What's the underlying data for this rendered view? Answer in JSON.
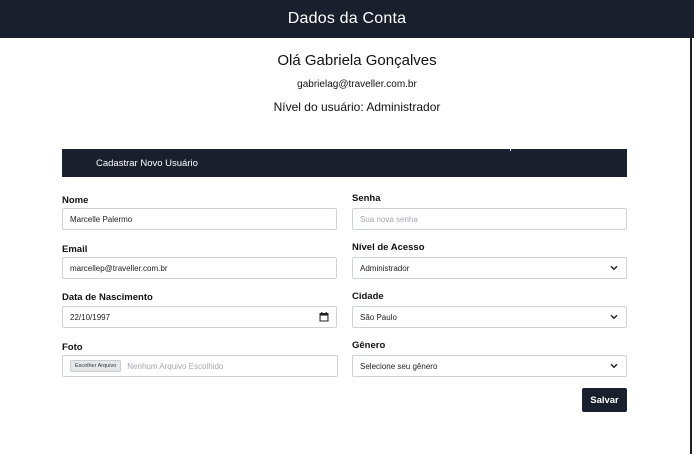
{
  "header": {
    "title": "Dados da Conta"
  },
  "profile": {
    "greeting": "Olá Gabriela Gonçalves",
    "email": "gabrielag@traveller.com.br",
    "level": "Nível do usuário: Administrador"
  },
  "form": {
    "section_title": "Cadastrar Novo Usuário",
    "name": {
      "label": "Nome",
      "value": "Marcelle Palermo"
    },
    "password": {
      "label": "Senha",
      "placeholder": "Sua nova senha"
    },
    "email": {
      "label": "Email",
      "value": "marcellep@traveller.com.br"
    },
    "access_level": {
      "label": "Nível de Acesso",
      "selected": "Administrador"
    },
    "birth_date": {
      "label": "Data de Nascimento",
      "value": "22/10/1997"
    },
    "city": {
      "label": "Cidade",
      "selected": "São Paulo"
    },
    "photo": {
      "label": "Foto",
      "button": "Escolher Arquivo",
      "status": "Nenhum Arquivo Escolhido"
    },
    "gender": {
      "label": "Gênero",
      "selected": "Selecione seu gênero"
    },
    "save_label": "Salvar"
  },
  "colors": {
    "navy": "#1a1f2e",
    "border": "#cfd3d9",
    "placeholder": "#a3a8b0"
  },
  "icons": {
    "select": "chevron-down-icon",
    "date": "calendar-icon"
  }
}
